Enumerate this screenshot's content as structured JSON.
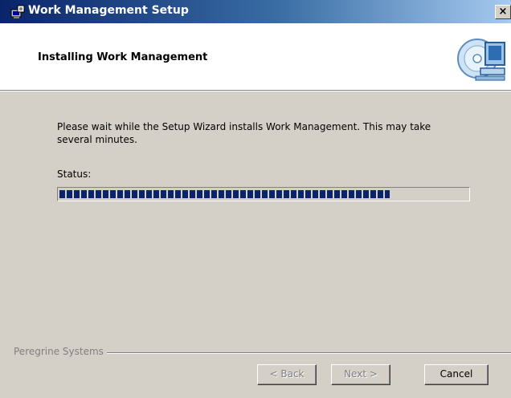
{
  "window": {
    "title": "Work Management Setup",
    "close_glyph": "×"
  },
  "header": {
    "title": "Installing Work Management",
    "graphic": "install-disk-computer-icon"
  },
  "body": {
    "description": "Please wait while the Setup Wizard installs Work Management.  This may take several minutes.",
    "status_label": "Status:",
    "progress_fraction": 0.81
  },
  "footer": {
    "brand": "Peregrine Systems",
    "back_label": "< Back",
    "next_label": "Next >",
    "cancel_label": "Cancel"
  },
  "colors": {
    "title_bar_start": "#0a246a",
    "title_bar_end": "#a6caf0",
    "progress_block": "#0a246a",
    "dialog_bg": "#d4d0c8"
  }
}
